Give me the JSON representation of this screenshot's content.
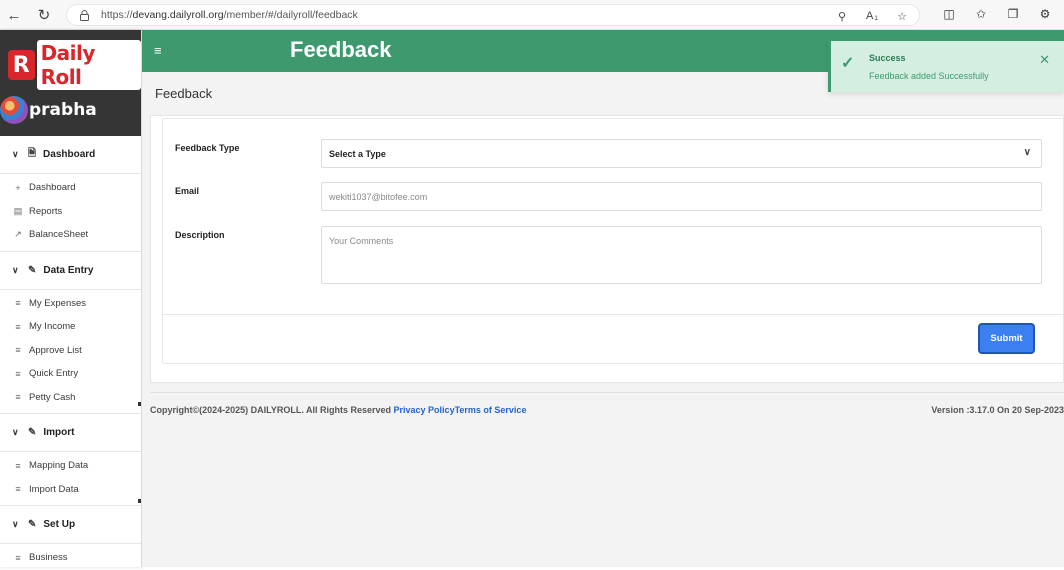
{
  "browser": {
    "url_prefix": "https://",
    "url_host": "devang.dailyroll.org",
    "url_path": "/member/#/dailyroll/feedback"
  },
  "sidebar": {
    "logo_mark": "R",
    "logo_text": "Daily Roll",
    "user_name": "prabha",
    "groups": [
      {
        "label": "Dashboard",
        "items": [
          "Dashboard",
          "Reports",
          "BalanceSheet"
        ]
      },
      {
        "label": "Data Entry",
        "items": [
          "My Expenses",
          "My Income",
          "Approve List",
          "Quick Entry",
          "Petty Cash"
        ]
      },
      {
        "label": "Import",
        "items": [
          "Mapping Data",
          "Import Data"
        ]
      },
      {
        "label": "Set Up",
        "items": [
          "Business"
        ]
      }
    ]
  },
  "header": {
    "title": "Feedback",
    "menu_icon": "hamburger-icon"
  },
  "toast": {
    "title": "Success",
    "message": "Feedback added Successfully"
  },
  "page": {
    "breadcrumb": "Feedback"
  },
  "form": {
    "type_label": "Feedback Type",
    "type_value": "Select a Type",
    "email_label": "Email",
    "email_value": "wekiti1037@bitofee.com",
    "description_label": "Description",
    "description_placeholder": "Your Comments",
    "submit_label": "Submit"
  },
  "footer": {
    "copyright": "Copyright©(2024-2025) DAILYROLL. All Rights Reserved ",
    "privacy_link": "Privacy Policy",
    "terms_link": "Terms of Service",
    "version": "Version :3.17.0 On 20 Sep-2023"
  },
  "colors": {
    "primary": "#3e9a6e",
    "toast_bg": "#d4eee1",
    "submit": "#3b7ff0",
    "sidebar_head": "#353535",
    "logo_red": "#d8262b"
  }
}
